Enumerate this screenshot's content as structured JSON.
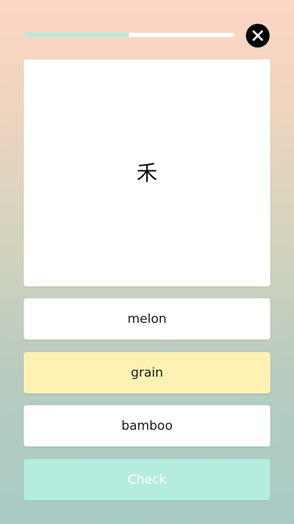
{
  "progress": {
    "fraction": 0.5,
    "track_color": "#ffffff",
    "fill_color": "#b4ecde"
  },
  "close_button": {
    "icon": "close-icon"
  },
  "question": {
    "character": "禾"
  },
  "options": [
    {
      "label": "melon",
      "selected": false
    },
    {
      "label": "grain",
      "selected": true
    },
    {
      "label": "bamboo",
      "selected": false
    }
  ],
  "check_button": {
    "label": "Check",
    "color": "#b4ecde"
  },
  "colors": {
    "selected_option": "#fdf2b3",
    "card": "#ffffff"
  }
}
